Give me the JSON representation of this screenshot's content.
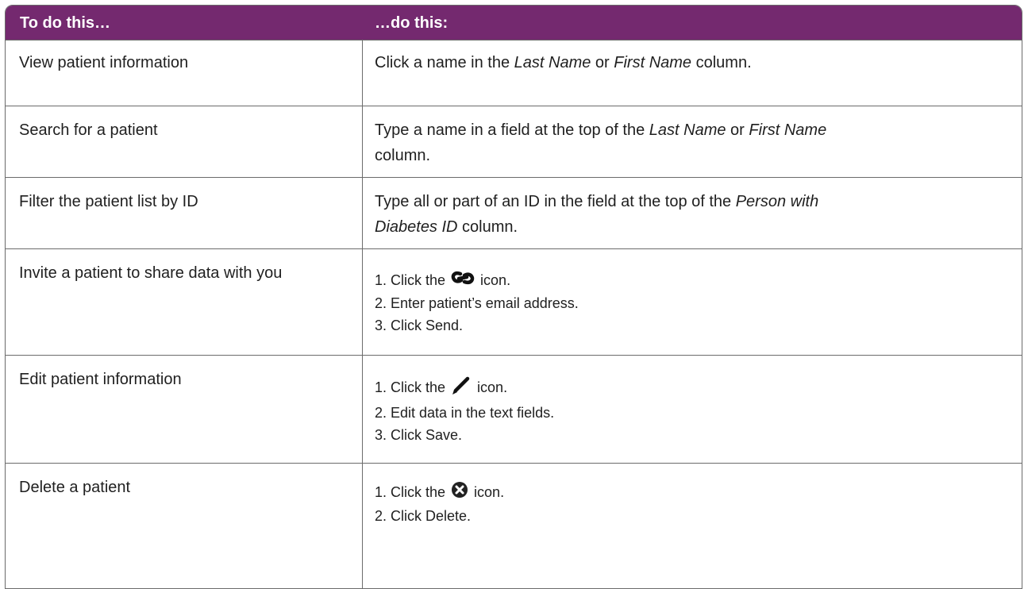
{
  "header": {
    "col1": "To do this…",
    "col2": "…do this:"
  },
  "rows": [
    {
      "action": "View patient information",
      "instruction": {
        "a": "Click a name in the ",
        "b": "Last Name",
        "c": " or ",
        "d": "First Name",
        "e": " column."
      }
    },
    {
      "action": "Search for a patient",
      "instruction": {
        "a": "Type a name in a field at the top of the ",
        "b": "Last Name",
        "c": " or ",
        "d": "First Name",
        "e": "column."
      }
    },
    {
      "action": "Filter the patient list by ID",
      "instruction": {
        "a": "Type all or part of an ID in the field at the top of the ",
        "b": "Person with",
        "c": "Diabetes ID",
        "d": " column."
      }
    },
    {
      "action": "Invite a patient to share data with you",
      "steps": {
        "s1a": "1. Click the ",
        "s1b": " icon.",
        "s2": "2. Enter patient’s email address.",
        "s3": "3. Click Send."
      },
      "icon": "link-icon"
    },
    {
      "action": "Edit patient information",
      "steps": {
        "s1a": "1.  Click the ",
        "s1b": " icon.",
        "s2": "2.  Edit data in the text fields.",
        "s3": "3.  Click Save."
      },
      "icon": "pencil-icon"
    },
    {
      "action": "Delete a patient",
      "steps": {
        "s1a": "1.  Click the ",
        "s1b": " icon.",
        "s2": "2.  Click Delete."
      },
      "icon": "delete-circle-icon"
    }
  ],
  "colors": {
    "header_bg": "#74296f",
    "border": "#6b6b6b"
  }
}
